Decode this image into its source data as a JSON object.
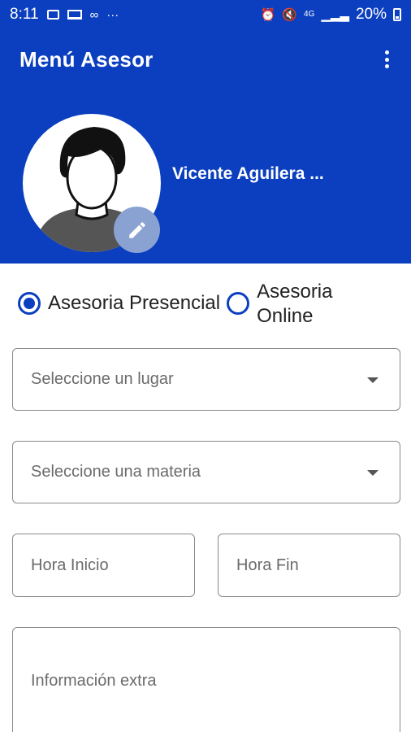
{
  "status_bar": {
    "time": "8:11",
    "battery": "20%",
    "left_icons": [
      "image-icon",
      "laptop-icon",
      "voicemail-icon",
      "more-dots-icon"
    ],
    "right_icons": [
      "alarm-icon",
      "mute-icon",
      "data-4g-icon",
      "signal-icon",
      "battery-icon"
    ]
  },
  "app_bar": {
    "title": "Menú Asesor",
    "overflow_icon": "more-vert-icon",
    "color": "#0b3fbf"
  },
  "profile": {
    "name": "Vicente Aguilera ...",
    "edit_icon": "pencil-icon"
  },
  "modality": {
    "options": [
      {
        "label": "Asesoria Presencial",
        "selected": true
      },
      {
        "label_line1": "Asesoria",
        "label_line2": "Online",
        "selected": false
      }
    ]
  },
  "form": {
    "lugar_placeholder": "Seleccione un lugar",
    "materia_placeholder": "Seleccione una materia",
    "hora_inicio_placeholder": "Hora Inicio",
    "hora_fin_placeholder": "Hora Fin",
    "info_extra_placeholder": "Información extra"
  }
}
